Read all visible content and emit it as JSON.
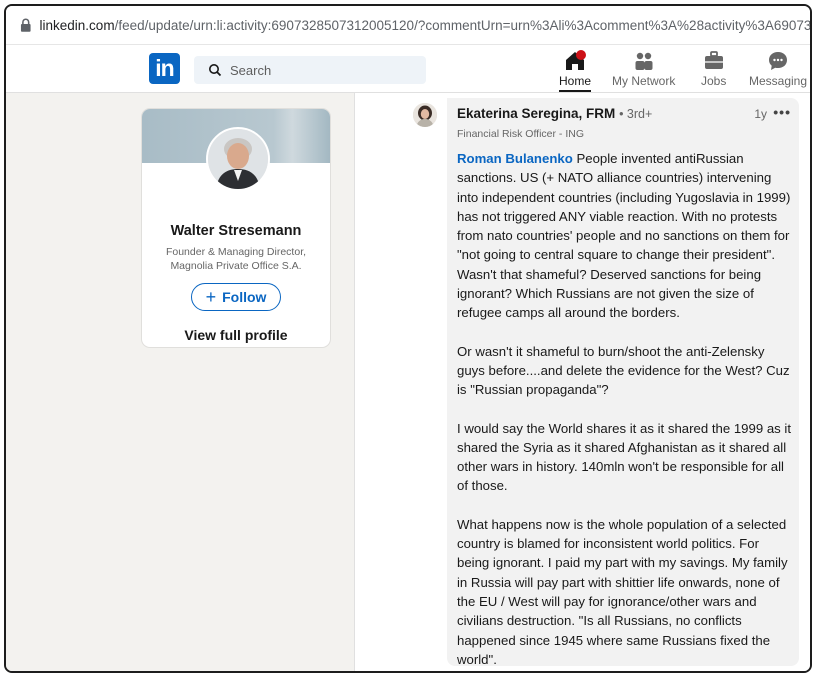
{
  "browser": {
    "url_host": "linkedin.com",
    "url_rest": "/feed/update/urn:li:activity:6907328507312005120/?commentUrn=urn%3Ali%3Acomment%3A%28activity%3A690732850"
  },
  "nav": {
    "logo": "in",
    "search_placeholder": "Search",
    "items": [
      {
        "label": "Home"
      },
      {
        "label": "My Network"
      },
      {
        "label": "Jobs"
      },
      {
        "label": "Messaging"
      }
    ]
  },
  "profile_card": {
    "name": "Walter Stresemann",
    "title": "Founder & Managing Director, Magnolia Private Office S.A.",
    "follow_label": "Follow",
    "view_profile_label": "View full profile"
  },
  "comment": {
    "author": "Ekaterina Seregina, FRM",
    "degree": "• 3rd+",
    "time": "1y",
    "more": "•••",
    "headline": "Financial Risk Officer - ING",
    "mention": "Roman Bulanenko",
    "paragraph1": " People invented antiRussian sanctions. US (+ NATO alliance countries) intervening into independent countries (including Yugoslavia in 1999) has not triggered ANY viable reaction. With no protests from nato countries' people and no sanctions on them for \"not going to central square to change their president\". Wasn't that shameful? Deserved sanctions for being ignorant? Which Russians are not given the size of refugee camps all around the borders.",
    "paragraph2": "Or wasn't it shameful to burn/shoot the anti-Zelensky guys before....and delete the evidence for the West? Cuz is \"Russian propaganda\"?",
    "paragraph3": "I would say the World shares it as it shared the 1999 as it shared the Syria as it shared Afghanistan as it shared all other wars in history. 140mln won't be responsible for all of those.",
    "paragraph4": "What happens now is the whole population of a selected country is blamed for inconsistent world politics. For being ignorant. I paid my part with my savings. My family in Russia will pay part with shittier life onwards, none of the EU / West will pay for ignorance/other wars and civilians destruction. \"Is all Russians, no conflicts happened since 1945 where same Russians fixed the world\"."
  },
  "colors": {
    "brand": "#0a66c2",
    "page_bg": "#f3f2ef",
    "bubble_bg": "#f2f2f2"
  }
}
